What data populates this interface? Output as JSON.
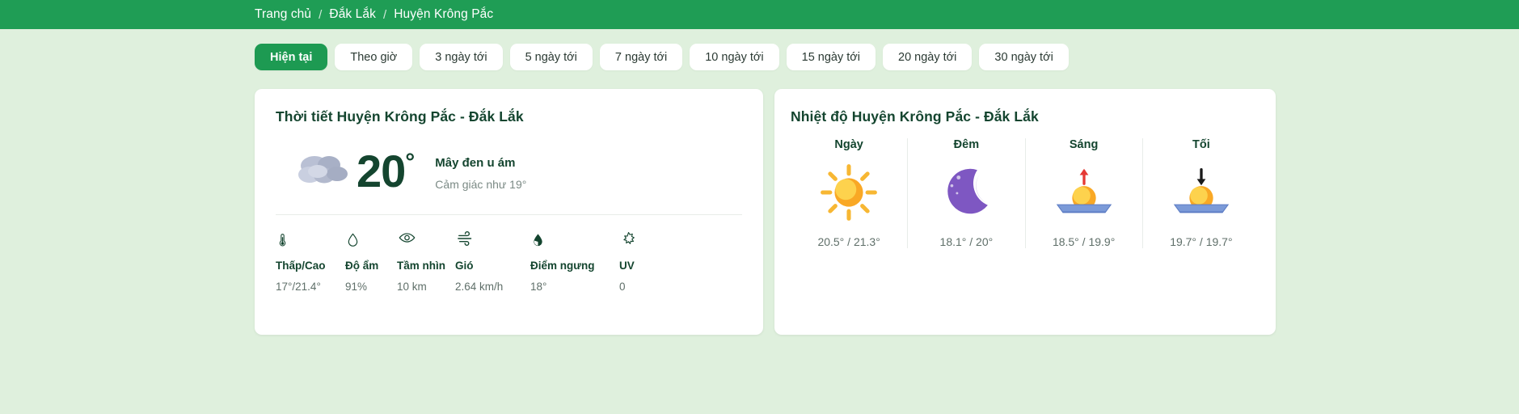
{
  "breadcrumb": {
    "home": "Trang chủ",
    "province": "Đắk Lắk",
    "district": "Huyện Krông Pắc",
    "separator": "/"
  },
  "tabs": [
    {
      "label": "Hiện tại",
      "active": true
    },
    {
      "label": "Theo giờ",
      "active": false
    },
    {
      "label": "3 ngày tới",
      "active": false
    },
    {
      "label": "5 ngày tới",
      "active": false
    },
    {
      "label": "7 ngày tới",
      "active": false
    },
    {
      "label": "10 ngày tới",
      "active": false
    },
    {
      "label": "15 ngày tới",
      "active": false
    },
    {
      "label": "20 ngày tới",
      "active": false
    },
    {
      "label": "30 ngày tới",
      "active": false
    }
  ],
  "weather_card": {
    "title": "Thời tiết Huyện Krông Pắc - Đắk Lắk",
    "temperature": "20",
    "degree_mark": "°",
    "condition": "Mây đen u ám",
    "feels_like": "Cảm giác như 19°",
    "condition_icon": "dark-clouds-icon",
    "metrics": [
      {
        "icon": "thermometer-icon",
        "label": "Thấp/Cao",
        "value": "17°/21.4°"
      },
      {
        "icon": "humidity-drop-icon",
        "label": "Độ ẩm",
        "value": "91%"
      },
      {
        "icon": "eye-visibility-icon",
        "label": "Tầm nhìn",
        "value": "10 km"
      },
      {
        "icon": "wind-icon",
        "label": "Gió",
        "value": "2.64 km/h"
      },
      {
        "icon": "dew-point-drop-icon",
        "label": "Điểm ngưng",
        "value": "18°"
      },
      {
        "icon": "uv-sun-icon",
        "label": "UV",
        "value": "0"
      }
    ]
  },
  "temperature_card": {
    "title": "Nhiệt độ Huyện Krông Pắc - Đắk Lắk",
    "dayparts": [
      {
        "label": "Ngày",
        "icon": "sun-icon",
        "value": "20.5° / 21.3°"
      },
      {
        "label": "Đêm",
        "icon": "moon-icon",
        "value": "18.1° / 20°"
      },
      {
        "label": "Sáng",
        "icon": "sunrise-icon",
        "value": "18.5° / 19.9°"
      },
      {
        "label": "Tối",
        "icon": "sunset-icon",
        "value": "19.7° / 19.7°"
      }
    ]
  },
  "colors": {
    "brand_green": "#1f9d55",
    "dark_green": "#14452f",
    "page_bg": "#dff0dd",
    "card_bg": "#ffffff"
  }
}
